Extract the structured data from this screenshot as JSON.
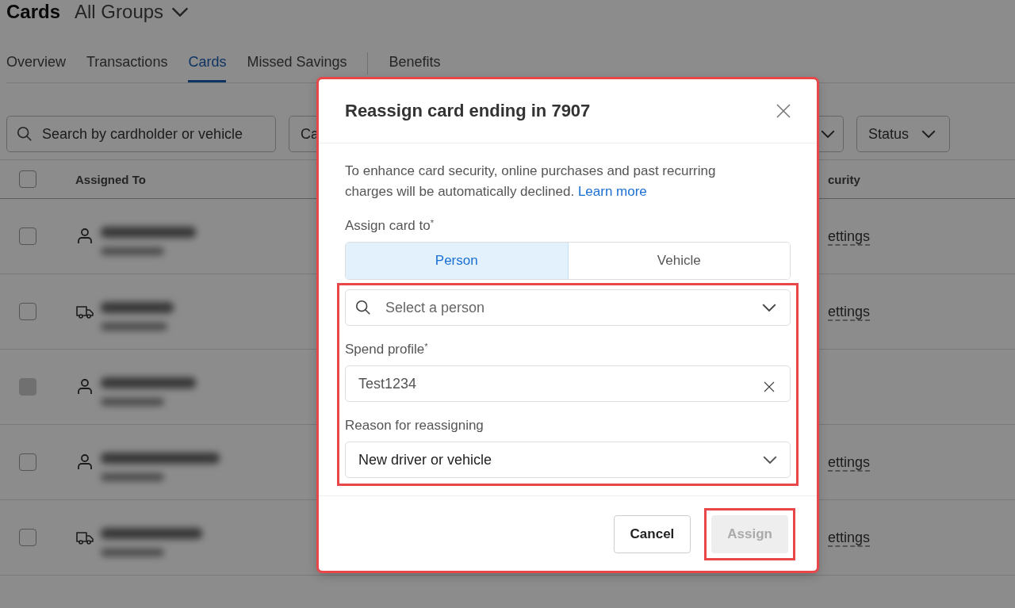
{
  "page": {
    "title": "Cards",
    "group_selector": "All Groups",
    "tabs": [
      {
        "label": "Overview",
        "selected": false
      },
      {
        "label": "Transactions",
        "selected": false
      },
      {
        "label": "Cards",
        "selected": true
      },
      {
        "label": "Missed Savings",
        "selected": false
      },
      {
        "label": "Benefits",
        "selected": false
      }
    ],
    "search": {
      "placeholder": "Search by cardholder or vehicle"
    },
    "filters": [
      "Ca",
      "Status"
    ],
    "table": {
      "columns": [
        "Assigned To",
        "curity"
      ],
      "header_checked": false,
      "rows": [
        {
          "kind": "person",
          "checked": false,
          "disabled": false,
          "column_2": "ettings"
        },
        {
          "kind": "vehicle",
          "checked": false,
          "disabled": false,
          "column_2": "ettings"
        },
        {
          "kind": "person",
          "checked": false,
          "disabled": true
        },
        {
          "kind": "person",
          "checked": false,
          "disabled": false,
          "column_2": "ettings"
        },
        {
          "kind": "vehicle",
          "checked": false,
          "disabled": false,
          "column_2": "ettings"
        }
      ]
    }
  },
  "dialog": {
    "title": "Reassign card ending in 7907",
    "highlighted": true,
    "message": "To enhance card security, online purchases and past recurring charges will be automatically declined.",
    "link": "Learn more",
    "assign_label": "Assign card to",
    "assign_required": true,
    "required_mark": "*",
    "segments": [
      {
        "label": "Person",
        "selected": true
      },
      {
        "label": "Vehicle",
        "selected": false
      }
    ],
    "fields_highlighted": true,
    "person_select": {
      "placeholder": "Select a person"
    },
    "spend_profile": {
      "label": "Spend profile",
      "required": true,
      "value": "Test1234"
    },
    "reason": {
      "label": "Reason for reassigning",
      "required": false,
      "value": "New driver or vehicle"
    },
    "buttons": [
      {
        "label": "Cancel",
        "kind": "secondary",
        "disabled": false,
        "highlighted": false
      },
      {
        "label": "Assign",
        "kind": "primary",
        "disabled": true,
        "highlighted": true
      }
    ]
  }
}
